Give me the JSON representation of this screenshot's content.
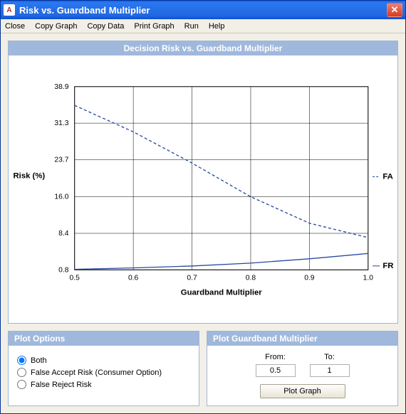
{
  "window": {
    "title": "Risk vs. Guardband Multiplier",
    "app_icon": "A",
    "close_glyph": "✕"
  },
  "menu": {
    "close": "Close",
    "copy_graph": "Copy Graph",
    "copy_data": "Copy Data",
    "print_graph": "Print Graph",
    "run": "Run",
    "help": "Help"
  },
  "chart_panel": {
    "title": "Decision Risk vs. Guardband Multiplier"
  },
  "chart_data": {
    "type": "line",
    "xlabel": "Guardband Multiplier",
    "ylabel": "Risk (%)",
    "x_ticks": [
      0.5,
      0.6,
      0.7,
      0.8,
      0.9,
      1.0
    ],
    "y_ticks": [
      0.8,
      8.4,
      16.0,
      23.7,
      31.3,
      38.9
    ],
    "xlim": [
      0.5,
      1.0
    ],
    "ylim": [
      0.8,
      38.9
    ],
    "series": [
      {
        "name": "FA",
        "style": "dashed",
        "color": "#2a4aa0",
        "x": [
          0.5,
          0.6,
          0.7,
          0.8,
          0.9,
          1.0
        ],
        "y": [
          35.0,
          29.5,
          23.0,
          16.0,
          10.5,
          7.5
        ]
      },
      {
        "name": "FR",
        "style": "solid",
        "color": "#2a4aa0",
        "x": [
          0.5,
          0.6,
          0.7,
          0.8,
          0.9,
          1.0
        ],
        "y": [
          0.9,
          1.2,
          1.6,
          2.2,
          3.1,
          4.2
        ]
      }
    ],
    "legend_items": [
      "FA",
      "FR"
    ]
  },
  "plot_options": {
    "title": "Plot Options",
    "option_both": "Both",
    "option_fa": "False Accept Risk (Consumer Option)",
    "option_fr": "False Reject Risk",
    "selected": "both"
  },
  "plot_range": {
    "title": "Plot Guardband Multiplier",
    "from_label": "From:",
    "to_label": "To:",
    "from_value": "0.5",
    "to_value": "1",
    "button_label": "Plot Graph"
  }
}
